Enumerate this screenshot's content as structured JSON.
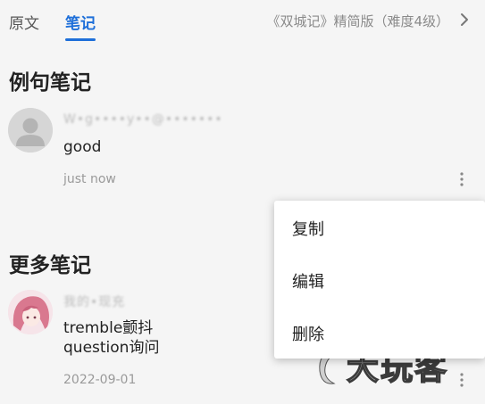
{
  "tabs": {
    "original": "原文",
    "notes": "笔记"
  },
  "book_title": "《双城记》精简版（难度4级）",
  "colors": {
    "accent": "#1e6fd9",
    "background": "#f5f5f5",
    "menu_background": "#ffffff"
  },
  "sections": {
    "example_notes": "例句笔记",
    "more_notes": "更多笔记"
  },
  "notes": [
    {
      "username": "W•g••••y••@•••••••",
      "lines": [
        "good"
      ],
      "timestamp": "just now",
      "avatar": "default-user-avatar"
    },
    {
      "username": "我的•现充",
      "lines": [
        "tremble颤抖",
        "question询问"
      ],
      "timestamp": "2022-09-01",
      "avatar": "anime-girl-avatar"
    }
  ],
  "context_menu": {
    "copy": "复制",
    "edit": "编辑",
    "delete": "删除"
  },
  "watermark": {
    "text": "大玩客"
  }
}
